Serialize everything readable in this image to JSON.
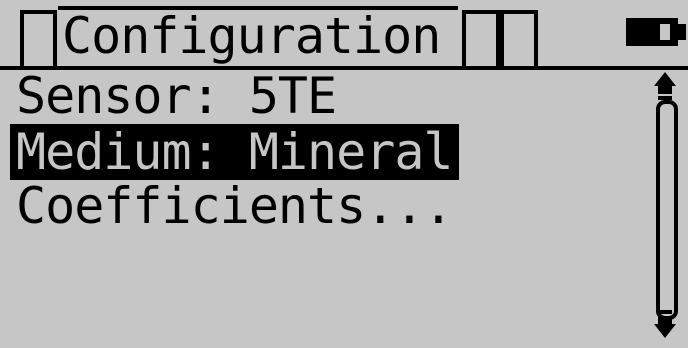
{
  "header": {
    "title": "Configuration",
    "icons": [
      "tab-frame-icon",
      "indicator-box-icon",
      "indicator-box-icon",
      "battery-icon"
    ]
  },
  "menu": {
    "items": [
      {
        "label": "Sensor: 5TE",
        "selected": false
      },
      {
        "label": "Medium: Mineral",
        "selected": true
      },
      {
        "label": "Coefficients...",
        "selected": false
      }
    ]
  },
  "scrollbar": {
    "icons": [
      "scroll-up-arrow-icon",
      "scroll-down-arrow-icon"
    ]
  },
  "colors": {
    "background": "#c6c6c6",
    "foreground": "#000000"
  }
}
